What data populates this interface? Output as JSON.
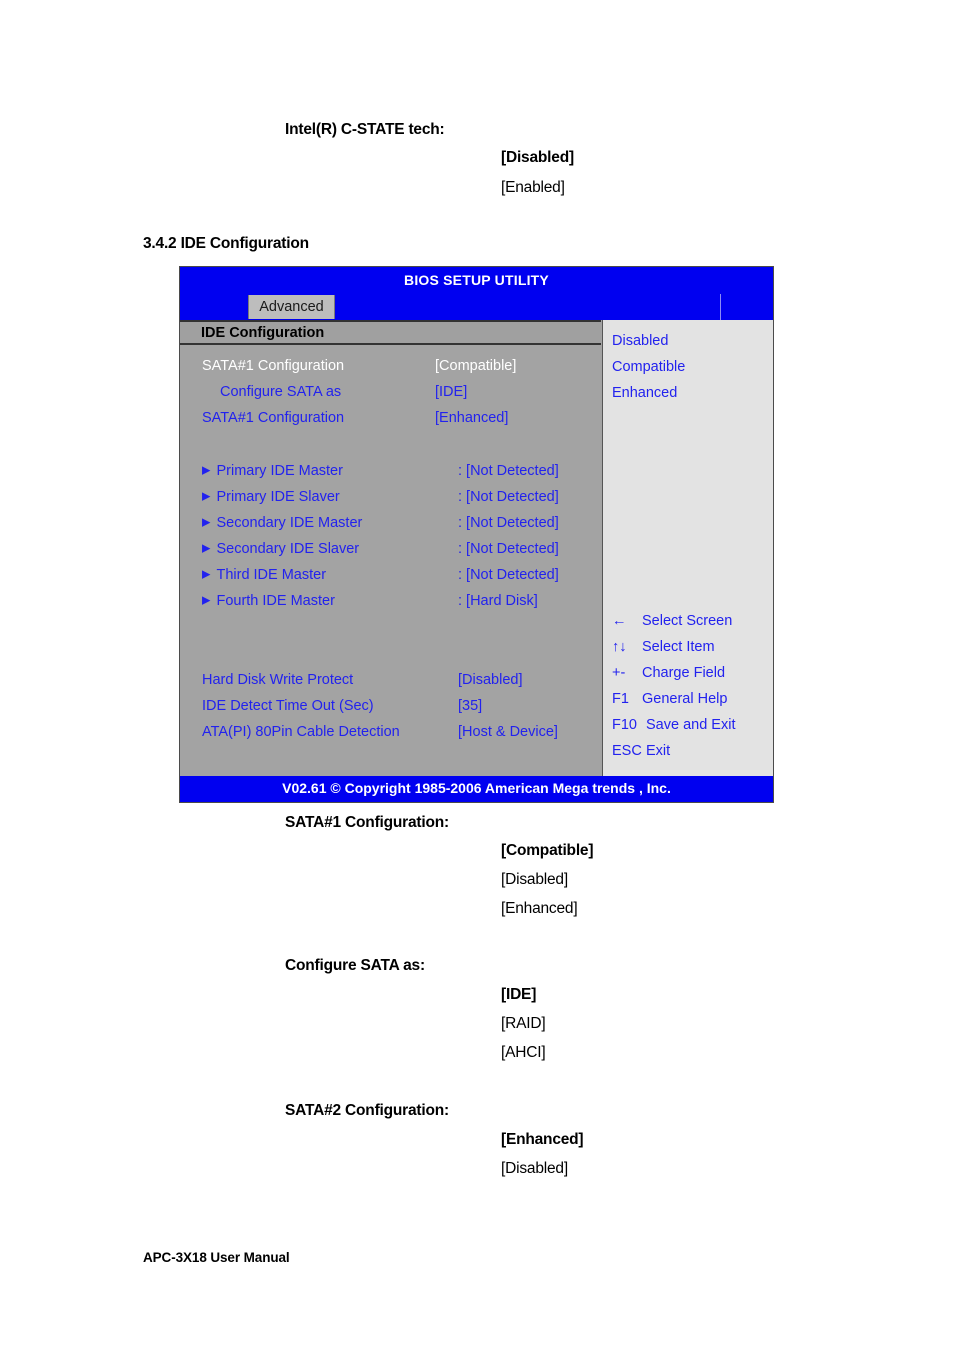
{
  "document": {
    "cstate": {
      "label": "Intel(R) C-STATE tech:",
      "options": [
        {
          "text": "[Disabled]",
          "bold": true
        },
        {
          "text": "[Enabled]",
          "bold": false
        }
      ]
    },
    "section_heading": "3.4.2 IDE Configuration",
    "blocks": [
      {
        "label": "SATA#1 Configuration:",
        "options": [
          {
            "text": "[Compatible]",
            "bold": true
          },
          {
            "text": "[Disabled]",
            "bold": false
          },
          {
            "text": "[Enhanced]",
            "bold": false
          }
        ]
      },
      {
        "label": "Configure SATA as:",
        "options": [
          {
            "text": "[IDE]",
            "bold": true
          },
          {
            "text": "[RAID]",
            "bold": false
          },
          {
            "text": "[AHCI]",
            "bold": false
          }
        ]
      },
      {
        "label": "SATA#2 Configuration:",
        "options": [
          {
            "text": "[Enhanced]",
            "bold": true
          },
          {
            "text": "[Disabled]",
            "bold": false
          }
        ]
      }
    ],
    "footer": "APC-3X18 User Manual"
  },
  "bios": {
    "title": "BIOS SETUP UTILITY",
    "active_tab": "Advanced",
    "section_title": "IDE Configuration",
    "settings": [
      {
        "label": "SATA#1 Configuration",
        "value": "[Compatible]",
        "selected": true,
        "indent": false,
        "arrow": false
      },
      {
        "label": "Configure SATA as",
        "value": "[IDE]",
        "selected": false,
        "indent": true,
        "arrow": false
      },
      {
        "label": "SATA#1 Configuration",
        "value": "[Enhanced]",
        "selected": false,
        "indent": false,
        "arrow": false
      }
    ],
    "devices": [
      {
        "label": "Primary IDE Master",
        "value": ": [Not Detected]"
      },
      {
        "label": "Primary IDE Slaver",
        "value": ": [Not Detected]"
      },
      {
        "label": "Secondary IDE Master",
        "value": ": [Not Detected]"
      },
      {
        "label": "Secondary IDE Slaver",
        "value": ": [Not Detected]"
      },
      {
        "label": "Third IDE Master",
        "value": ": [Not Detected]"
      },
      {
        "label": "Fourth IDE Master",
        "value": ": [Hard Disk]"
      }
    ],
    "extras": [
      {
        "label": "Hard Disk Write Protect",
        "value": "[Disabled]"
      },
      {
        "label": "IDE Detect Time Out (Sec)",
        "value": "[35]"
      },
      {
        "label": "ATA(PI) 80Pin Cable Detection",
        "value": "[Host & Device]"
      }
    ],
    "help_options": [
      "Disabled",
      "Compatible",
      "Enhanced"
    ],
    "nav_keys": [
      {
        "key": "←",
        "action": "Select Screen"
      },
      {
        "key": "↑↓",
        "action": "Select Item"
      },
      {
        "key": "+-",
        "action": "Charge Field"
      },
      {
        "key": "F1",
        "action": "General Help"
      },
      {
        "key": "F10",
        "action": "Save and Exit"
      },
      {
        "key": "ESC",
        "action": "Exit"
      }
    ],
    "copyright": "V02.61 © Copyright 1985-2006 American Mega trends , Inc.",
    "arrow_glyph": "▶",
    "colors": {
      "header_blue": "#0000f0",
      "pane_gray": "#a3a3a3",
      "help_gray": "#e3e3e3",
      "text_blue": "#2222ee",
      "selected_white": "#ffffff"
    }
  }
}
